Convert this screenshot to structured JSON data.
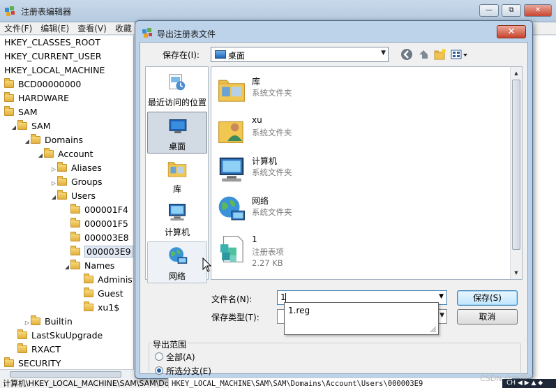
{
  "regedit": {
    "title": "注册表编辑器",
    "window_buttons": [
      "—",
      "⧉",
      "✕"
    ],
    "menu": [
      "文件(F)",
      "编辑(E)",
      "查看(V)",
      "收藏"
    ],
    "tree": [
      {
        "label": "HKEY_CLASSES_ROOT",
        "indent": 0,
        "folder": false,
        "arrow": ""
      },
      {
        "label": "HKEY_CURRENT_USER",
        "indent": 0,
        "folder": false,
        "arrow": ""
      },
      {
        "label": "HKEY_LOCAL_MACHINE",
        "indent": 0,
        "folder": false,
        "arrow": ""
      },
      {
        "label": "BCD00000000",
        "indent": 0,
        "folder": true,
        "arrow": ""
      },
      {
        "label": "HARDWARE",
        "indent": 0,
        "folder": true,
        "arrow": ""
      },
      {
        "label": "SAM",
        "indent": 0,
        "folder": true,
        "arrow": ""
      },
      {
        "label": "SAM",
        "indent": 1,
        "folder": true,
        "arrow": "◢"
      },
      {
        "label": "Domains",
        "indent": 2,
        "folder": true,
        "arrow": "◢"
      },
      {
        "label": "Account",
        "indent": 3,
        "folder": true,
        "arrow": "◢"
      },
      {
        "label": "Aliases",
        "indent": 4,
        "folder": true,
        "arrow": "▷"
      },
      {
        "label": "Groups",
        "indent": 4,
        "folder": true,
        "arrow": "▷"
      },
      {
        "label": "Users",
        "indent": 4,
        "folder": true,
        "arrow": "◢"
      },
      {
        "label": "000001F4",
        "indent": 5,
        "folder": true,
        "arrow": ""
      },
      {
        "label": "000001F5",
        "indent": 5,
        "folder": true,
        "arrow": ""
      },
      {
        "label": "000003E8",
        "indent": 5,
        "folder": true,
        "arrow": ""
      },
      {
        "label": "000003E9",
        "indent": 5,
        "folder": true,
        "arrow": "",
        "selected": true
      },
      {
        "label": "Names",
        "indent": 5,
        "folder": true,
        "arrow": "◢"
      },
      {
        "label": "Administ",
        "indent": 6,
        "folder": true,
        "arrow": ""
      },
      {
        "label": "Guest",
        "indent": 6,
        "folder": true,
        "arrow": ""
      },
      {
        "label": "xu1$",
        "indent": 6,
        "folder": true,
        "arrow": ""
      },
      {
        "label": "Builtin",
        "indent": 2,
        "folder": true,
        "arrow": "▷"
      },
      {
        "label": "LastSkuUpgrade",
        "indent": 1,
        "folder": true,
        "arrow": ""
      },
      {
        "label": "RXACT",
        "indent": 1,
        "folder": true,
        "arrow": ""
      },
      {
        "label": "SECURITY",
        "indent": 0,
        "folder": true,
        "arrow": ""
      }
    ],
    "status": "计算机\\HKEY_LOCAL_MACHINE\\SAM\\SAM\\Domains\\Account\\Users\\000003E9"
  },
  "dialog": {
    "title": "导出注册表文件",
    "close": "✕",
    "save_in_label": "保存在(I):",
    "save_in_value": "桌面",
    "places": [
      {
        "label": "最近访问的位置",
        "icon": "recent-places-icon",
        "state": ""
      },
      {
        "label": "桌面",
        "icon": "desktop-icon",
        "state": "active"
      },
      {
        "label": "库",
        "icon": "libraries-icon",
        "state": ""
      },
      {
        "label": "计算机",
        "icon": "computer-icon",
        "state": ""
      },
      {
        "label": "网络",
        "icon": "network-icon",
        "state": "hover"
      }
    ],
    "files": [
      {
        "name": "库",
        "type": "系统文件夹",
        "size": "",
        "icon": "libraries-icon"
      },
      {
        "name": "xu",
        "type": "系统文件夹",
        "size": "",
        "icon": "user-folder-icon"
      },
      {
        "name": "计算机",
        "type": "系统文件夹",
        "size": "",
        "icon": "computer-icon"
      },
      {
        "name": "网络",
        "type": "系统文件夹",
        "size": "",
        "icon": "network-icon"
      },
      {
        "name": "1",
        "type": "注册表项",
        "size": "2.27 KB",
        "icon": "registry-file-icon"
      }
    ],
    "filename_label": "文件名(N):",
    "filename_value": "1",
    "filetype_label": "保存类型(T):",
    "autocomplete": [
      "1.reg"
    ],
    "save_button": "保存(S)",
    "cancel_button": "取消",
    "export_range_label": "导出范围",
    "radio_all": "全部(A)",
    "radio_branch": "所选分支(E)",
    "selected_radio": "branch",
    "branch_path": "HKEY_LOCAL_MACHINE\\SAM\\SAM\\Domains\\Account\\Users\\000003E9"
  },
  "overlay": {
    "watermark": "CSDN @世明年",
    "ime": "CH ◀ ▶ ▲ ◆"
  },
  "colors": {
    "dialog_frame": "#bcd3ea",
    "default_button": "#bee6fd",
    "selection": "#d2dae4"
  }
}
